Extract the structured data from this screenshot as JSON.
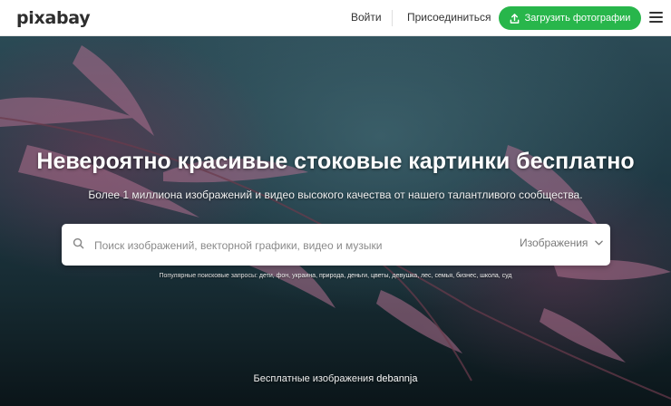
{
  "header": {
    "logo_text": "pixabay",
    "login_label": "Войти",
    "join_label": "Присоединиться",
    "upload_label": "Загрузить фотографии",
    "upload_icon": "upload-icon",
    "menu_icon": "hamburger-menu-icon",
    "accent_color": "#28b64b"
  },
  "hero": {
    "title": "Невероятно красивые стоковые картинки бесплатно",
    "subtitle": "Более 1 миллиона изображений и видео высокого качества от нашего талантливого сообщества.",
    "search": {
      "placeholder": "Поиск изображений, векторной графики, видео и музыки",
      "value": "",
      "type_selected": "Изображения",
      "search_icon": "search-icon",
      "dropdown_icon": "chevron-down-icon"
    },
    "popular": {
      "label": "Популярные поисковые запросы:",
      "terms": [
        "дети",
        "фон",
        "украина",
        "природа",
        "деньги",
        "цветы",
        "девушка",
        "лес",
        "семья",
        "бизнес",
        "школа",
        "суд"
      ]
    },
    "credit": {
      "prefix": "Бесплатные изображения",
      "author": "debannja"
    }
  }
}
